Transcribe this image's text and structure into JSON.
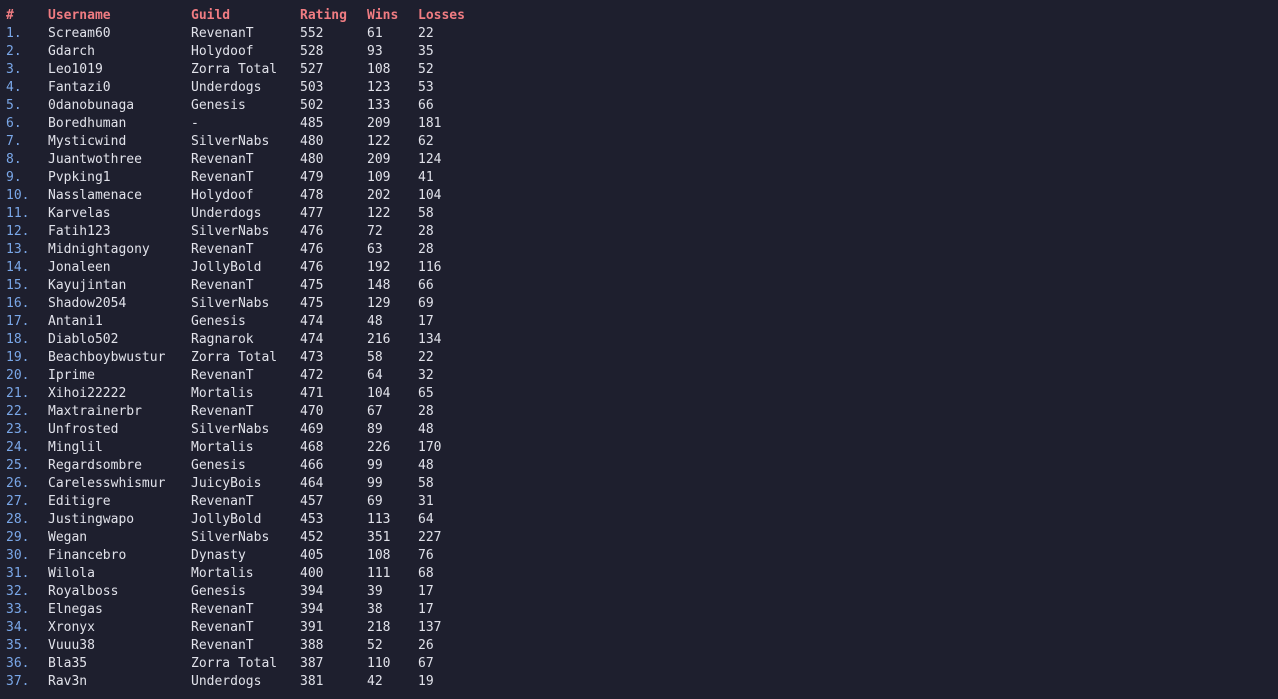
{
  "headers": {
    "rank": "#",
    "username": "Username",
    "guild": "Guild",
    "rating": "Rating",
    "wins": "Wins",
    "losses": "Losses"
  },
  "colors": {
    "background": "#1e1f2e",
    "header": "#f07c82",
    "rank": "#7aa7e8",
    "text": "#e1e2ea"
  },
  "rows": [
    {
      "rank": "1.",
      "username": "Scream60",
      "guild": "RevenanT",
      "rating": "552",
      "wins": "61",
      "losses": "22"
    },
    {
      "rank": "2.",
      "username": "Gdarch",
      "guild": "Holydoof",
      "rating": "528",
      "wins": "93",
      "losses": "35"
    },
    {
      "rank": "3.",
      "username": "Leo1019",
      "guild": "Zorra Total",
      "rating": "527",
      "wins": "108",
      "losses": "52"
    },
    {
      "rank": "4.",
      "username": "Fantazi0",
      "guild": "Underdogs",
      "rating": "503",
      "wins": "123",
      "losses": "53"
    },
    {
      "rank": "5.",
      "username": "0danobunaga",
      "guild": "Genesis",
      "rating": "502",
      "wins": "133",
      "losses": "66"
    },
    {
      "rank": "6.",
      "username": "Boredhuman",
      "guild": "-",
      "rating": "485",
      "wins": "209",
      "losses": "181"
    },
    {
      "rank": "7.",
      "username": "Mysticwind",
      "guild": "SilverNabs",
      "rating": "480",
      "wins": "122",
      "losses": "62"
    },
    {
      "rank": "8.",
      "username": "Juantwothree",
      "guild": "RevenanT",
      "rating": "480",
      "wins": "209",
      "losses": "124"
    },
    {
      "rank": "9.",
      "username": "Pvpking1",
      "guild": "RevenanT",
      "rating": "479",
      "wins": "109",
      "losses": "41"
    },
    {
      "rank": "10.",
      "username": "Nasslamenace",
      "guild": "Holydoof",
      "rating": "478",
      "wins": "202",
      "losses": "104"
    },
    {
      "rank": "11.",
      "username": "Karvelas",
      "guild": "Underdogs",
      "rating": "477",
      "wins": "122",
      "losses": "58"
    },
    {
      "rank": "12.",
      "username": "Fatih123",
      "guild": "SilverNabs",
      "rating": "476",
      "wins": "72",
      "losses": "28"
    },
    {
      "rank": "13.",
      "username": "Midnightagony",
      "guild": "RevenanT",
      "rating": "476",
      "wins": "63",
      "losses": "28"
    },
    {
      "rank": "14.",
      "username": "Jonaleen",
      "guild": "JollyBold",
      "rating": "476",
      "wins": "192",
      "losses": "116"
    },
    {
      "rank": "15.",
      "username": "Kayujintan",
      "guild": "RevenanT",
      "rating": "475",
      "wins": "148",
      "losses": "66"
    },
    {
      "rank": "16.",
      "username": "Shadow2054",
      "guild": "SilverNabs",
      "rating": "475",
      "wins": "129",
      "losses": "69"
    },
    {
      "rank": "17.",
      "username": "Antani1",
      "guild": "Genesis",
      "rating": "474",
      "wins": "48",
      "losses": "17"
    },
    {
      "rank": "18.",
      "username": "Diablo502",
      "guild": "Ragnarok",
      "rating": "474",
      "wins": "216",
      "losses": "134"
    },
    {
      "rank": "19.",
      "username": "Beachboybwustur",
      "guild": "Zorra Total",
      "rating": "473",
      "wins": "58",
      "losses": "22"
    },
    {
      "rank": "20.",
      "username": "Iprime",
      "guild": "RevenanT",
      "rating": "472",
      "wins": "64",
      "losses": "32"
    },
    {
      "rank": "21.",
      "username": "Xihoi22222",
      "guild": "Mortalis",
      "rating": "471",
      "wins": "104",
      "losses": "65"
    },
    {
      "rank": "22.",
      "username": "Maxtrainerbr",
      "guild": "RevenanT",
      "rating": "470",
      "wins": "67",
      "losses": "28"
    },
    {
      "rank": "23.",
      "username": "Unfrosted",
      "guild": "SilverNabs",
      "rating": "469",
      "wins": "89",
      "losses": "48"
    },
    {
      "rank": "24.",
      "username": "Minglil",
      "guild": "Mortalis",
      "rating": "468",
      "wins": "226",
      "losses": "170"
    },
    {
      "rank": "25.",
      "username": "Regardsombre",
      "guild": "Genesis",
      "rating": "466",
      "wins": "99",
      "losses": "48"
    },
    {
      "rank": "26.",
      "username": "Carelesswhismur",
      "guild": "JuicyBois",
      "rating": "464",
      "wins": "99",
      "losses": "58"
    },
    {
      "rank": "27.",
      "username": "Editigre",
      "guild": "RevenanT",
      "rating": "457",
      "wins": "69",
      "losses": "31"
    },
    {
      "rank": "28.",
      "username": "Justingwapo",
      "guild": "JollyBold",
      "rating": "453",
      "wins": "113",
      "losses": "64"
    },
    {
      "rank": "29.",
      "username": "Wegan",
      "guild": "SilverNabs",
      "rating": "452",
      "wins": "351",
      "losses": "227"
    },
    {
      "rank": "30.",
      "username": "Financebro",
      "guild": "Dynasty",
      "rating": "405",
      "wins": "108",
      "losses": "76"
    },
    {
      "rank": "31.",
      "username": "Wilola",
      "guild": "Mortalis",
      "rating": "400",
      "wins": "111",
      "losses": "68"
    },
    {
      "rank": "32.",
      "username": "Royalboss",
      "guild": "Genesis",
      "rating": "394",
      "wins": "39",
      "losses": "17"
    },
    {
      "rank": "33.",
      "username": "Elnegas",
      "guild": "RevenanT",
      "rating": "394",
      "wins": "38",
      "losses": "17"
    },
    {
      "rank": "34.",
      "username": "Xronyx",
      "guild": "RevenanT",
      "rating": "391",
      "wins": "218",
      "losses": "137"
    },
    {
      "rank": "35.",
      "username": "Vuuu38",
      "guild": "RevenanT",
      "rating": "388",
      "wins": "52",
      "losses": "26"
    },
    {
      "rank": "36.",
      "username": "Bla35",
      "guild": "Zorra Total",
      "rating": "387",
      "wins": "110",
      "losses": "67"
    },
    {
      "rank": "37.",
      "username": "Rav3n",
      "guild": "Underdogs",
      "rating": "381",
      "wins": "42",
      "losses": "19"
    }
  ]
}
